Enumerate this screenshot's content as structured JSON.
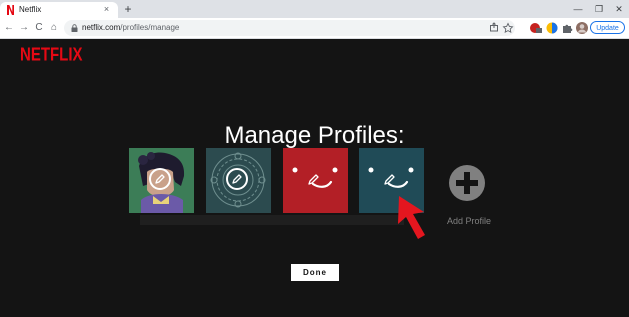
{
  "browser": {
    "tab_title": "Netflix",
    "tab_close_glyph": "×",
    "new_tab_glyph": "+",
    "window_controls": [
      "—",
      "❐",
      "✕"
    ],
    "nav": {
      "back": "←",
      "forward": "→",
      "reload": "C",
      "home": "⌂"
    },
    "url_host": "netflix.com",
    "url_path": "/profiles/manage",
    "update_label": "Update",
    "colors": {
      "tabstrip": "#dee1e6",
      "accent": "#1a73e8"
    }
  },
  "page": {
    "logo": "NETFLIX",
    "heading": "Manage Profiles:",
    "profiles": [
      {
        "id": "anime-avatar",
        "background": "#3c7d57",
        "icon": "pencil-icon"
      },
      {
        "id": "mandala-avatar",
        "background": "#2c4b4f",
        "icon": "pencil-icon"
      },
      {
        "id": "red-smile-avatar",
        "background": "#b31f26",
        "icon": "pencil-icon"
      },
      {
        "id": "teal-smile-avatar",
        "background": "#204b57",
        "icon": "pencil-icon"
      }
    ],
    "add_profile_label": "Add Profile",
    "done_label": "Done",
    "colors": {
      "brand": "#e50914",
      "background": "#141414"
    }
  }
}
